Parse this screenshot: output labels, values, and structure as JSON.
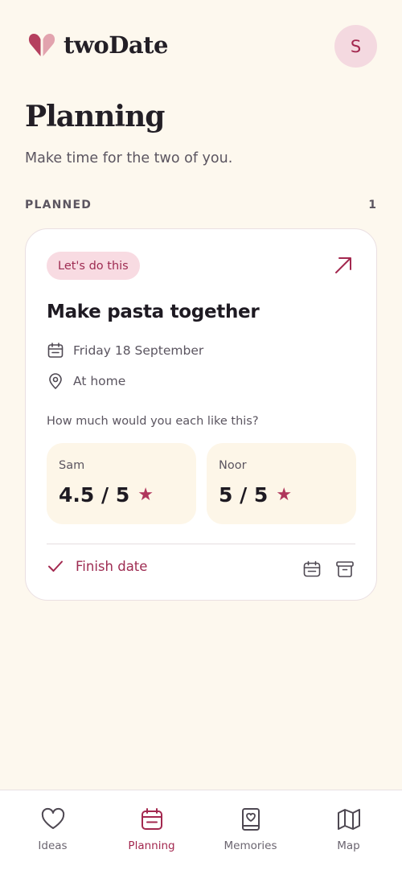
{
  "app": {
    "name": "twoDate",
    "avatar_initial": "S"
  },
  "page": {
    "title": "Planning",
    "subtitle": "Make time for the two of you."
  },
  "section": {
    "label": "PLANNED",
    "count": "1"
  },
  "card": {
    "badge": "Let's do this",
    "title": "Make pasta together",
    "date": "Friday 18 September",
    "location": "At home",
    "question": "How much would you each like this?",
    "ratings": [
      {
        "name": "Sam",
        "value": "4.5 / 5"
      },
      {
        "name": "Noor",
        "value": "5 / 5"
      }
    ],
    "finish_label": "Finish date"
  },
  "nav": {
    "items": [
      {
        "label": "Ideas",
        "icon": "heart-icon"
      },
      {
        "label": "Planning",
        "icon": "calendar-icon",
        "active": true
      },
      {
        "label": "Memories",
        "icon": "book-heart-icon"
      },
      {
        "label": "Map",
        "icon": "map-icon"
      }
    ]
  },
  "colors": {
    "background": "#fdf8ee",
    "accent": "#a3284f",
    "badge_bg": "#f8dbe2",
    "rating_bg": "#fdf6e8"
  }
}
